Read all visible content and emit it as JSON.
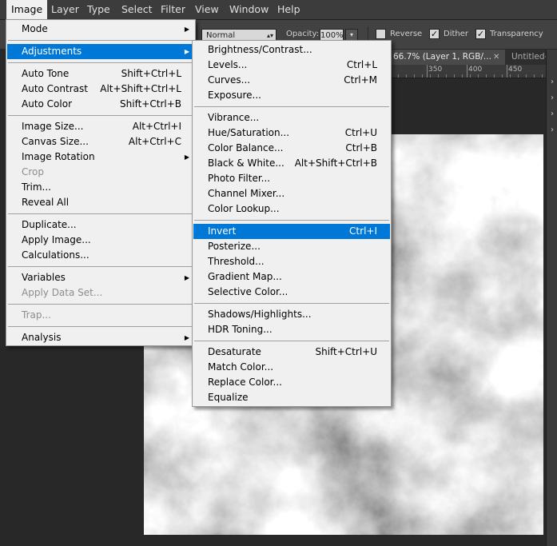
{
  "menubar": {
    "items": [
      "Image",
      "Layer",
      "Type",
      "Select",
      "Filter",
      "View",
      "Window",
      "Help"
    ],
    "active": "Image"
  },
  "options": {
    "blend_mode": "Normal",
    "opacity_label": "Opacity:",
    "opacity_value": "100%",
    "reverse_label": "Reverse",
    "reverse_checked": false,
    "dither_label": "Dither",
    "dither_checked": true,
    "transparency_label": "Transparency",
    "transparency_checked": true
  },
  "tabs": {
    "active_title": "66.7% (Layer 1, RGB/...",
    "other_title": "Untitled-"
  },
  "ruler": {
    "labels": [
      "350",
      "400",
      "450"
    ]
  },
  "image_menu": {
    "items": [
      {
        "label": "Mode",
        "shortcut": "",
        "submenu": true,
        "disabled": false
      },
      {
        "sep": true
      },
      {
        "label": "Adjustments",
        "shortcut": "",
        "submenu": true,
        "disabled": false,
        "highlight": true
      },
      {
        "sep": true
      },
      {
        "label": "Auto Tone",
        "shortcut": "Shift+Ctrl+L"
      },
      {
        "label": "Auto Contrast",
        "shortcut": "Alt+Shift+Ctrl+L"
      },
      {
        "label": "Auto Color",
        "shortcut": "Shift+Ctrl+B"
      },
      {
        "sep": true
      },
      {
        "label": "Image Size...",
        "shortcut": "Alt+Ctrl+I"
      },
      {
        "label": "Canvas Size...",
        "shortcut": "Alt+Ctrl+C"
      },
      {
        "label": "Image Rotation",
        "shortcut": "",
        "submenu": true
      },
      {
        "label": "Crop",
        "shortcut": "",
        "disabled": true
      },
      {
        "label": "Trim...",
        "shortcut": ""
      },
      {
        "label": "Reveal All",
        "shortcut": ""
      },
      {
        "sep": true
      },
      {
        "label": "Duplicate...",
        "shortcut": ""
      },
      {
        "label": "Apply Image...",
        "shortcut": ""
      },
      {
        "label": "Calculations...",
        "shortcut": ""
      },
      {
        "sep": true
      },
      {
        "label": "Variables",
        "shortcut": "",
        "submenu": true
      },
      {
        "label": "Apply Data Set...",
        "shortcut": "",
        "disabled": true
      },
      {
        "sep": true
      },
      {
        "label": "Trap...",
        "shortcut": "",
        "disabled": true
      },
      {
        "sep": true
      },
      {
        "label": "Analysis",
        "shortcut": "",
        "submenu": true
      }
    ]
  },
  "adjustments_menu": {
    "items": [
      {
        "label": "Brightness/Contrast...",
        "shortcut": ""
      },
      {
        "label": "Levels...",
        "shortcut": "Ctrl+L"
      },
      {
        "label": "Curves...",
        "shortcut": "Ctrl+M"
      },
      {
        "label": "Exposure...",
        "shortcut": ""
      },
      {
        "sep": true
      },
      {
        "label": "Vibrance...",
        "shortcut": ""
      },
      {
        "label": "Hue/Saturation...",
        "shortcut": "Ctrl+U"
      },
      {
        "label": "Color Balance...",
        "shortcut": "Ctrl+B"
      },
      {
        "label": "Black & White...",
        "shortcut": "Alt+Shift+Ctrl+B"
      },
      {
        "label": "Photo Filter...",
        "shortcut": ""
      },
      {
        "label": "Channel Mixer...",
        "shortcut": ""
      },
      {
        "label": "Color Lookup...",
        "shortcut": ""
      },
      {
        "sep": true
      },
      {
        "label": "Invert",
        "shortcut": "Ctrl+I",
        "highlight": true
      },
      {
        "label": "Posterize...",
        "shortcut": ""
      },
      {
        "label": "Threshold...",
        "shortcut": ""
      },
      {
        "label": "Gradient Map...",
        "shortcut": ""
      },
      {
        "label": "Selective Color...",
        "shortcut": ""
      },
      {
        "sep": true
      },
      {
        "label": "Shadows/Highlights...",
        "shortcut": ""
      },
      {
        "label": "HDR Toning...",
        "shortcut": ""
      },
      {
        "sep": true
      },
      {
        "label": "Desaturate",
        "shortcut": "Shift+Ctrl+U"
      },
      {
        "label": "Match Color...",
        "shortcut": ""
      },
      {
        "label": "Replace Color...",
        "shortcut": ""
      },
      {
        "label": "Equalize",
        "shortcut": ""
      }
    ]
  },
  "colors": {
    "highlight": "#0078d7",
    "menu_bg": "#f0f0f0",
    "app_bg": "#282828"
  }
}
